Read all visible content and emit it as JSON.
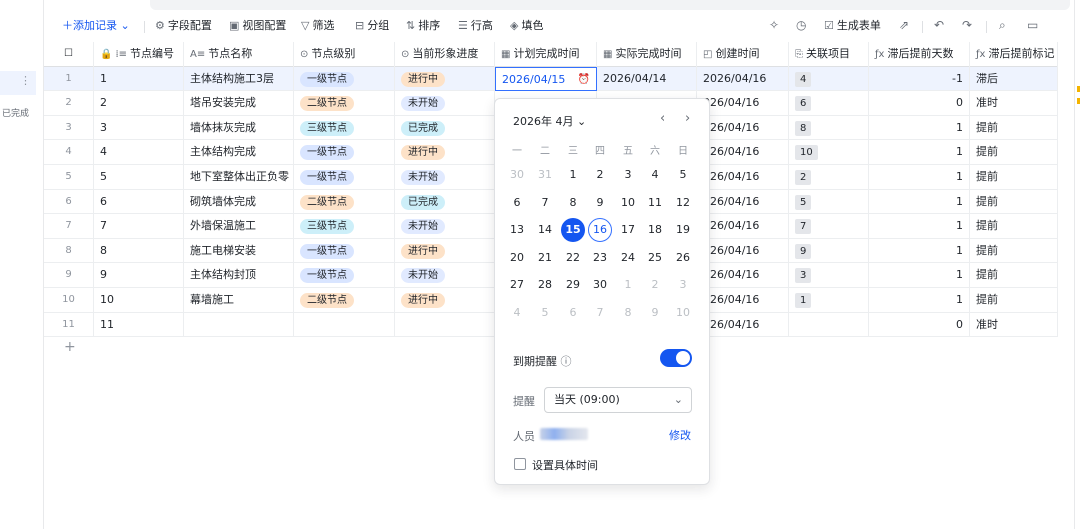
{
  "sidebar": {
    "status_label": "已完成"
  },
  "toolbar": {
    "add_record": "添加记录",
    "field_config": "字段配置",
    "view_config": "视图配置",
    "filter": "筛选",
    "group": "分组",
    "sort": "排序",
    "row_height": "行高",
    "fill_color": "填色",
    "generate_form": "生成表单"
  },
  "columns": [
    "节点编号",
    "节点名称",
    "节点级别",
    "当前形象进度",
    "计划完成时间",
    "实际完成时间",
    "创建时间",
    "关联项目",
    "滞后提前天数",
    "滞后提前标记"
  ],
  "rows": [
    {
      "rn": "1",
      "id": "1",
      "name": "主体结构施工3层",
      "level": "一级节点",
      "status": "进行中",
      "plan": "2026/04/15",
      "actual": "2026/04/14",
      "created": "2026/04/16",
      "rel": "4",
      "days": "-1",
      "mark": "滞后"
    },
    {
      "rn": "2",
      "id": "2",
      "name": "塔吊安装完成",
      "level": "二级节点",
      "status": "未开始",
      "plan": "",
      "actual": "",
      "created": "026/04/16",
      "rel": "6",
      "days": "0",
      "mark": "准时"
    },
    {
      "rn": "3",
      "id": "3",
      "name": "墙体抹灰完成",
      "level": "三级节点",
      "status": "已完成",
      "plan": "",
      "actual": "",
      "created": "026/04/16",
      "rel": "8",
      "days": "1",
      "mark": "提前"
    },
    {
      "rn": "4",
      "id": "4",
      "name": "主体结构完成",
      "level": "一级节点",
      "status": "进行中",
      "plan": "",
      "actual": "",
      "created": "026/04/16",
      "rel": "10",
      "days": "1",
      "mark": "提前"
    },
    {
      "rn": "5",
      "id": "5",
      "name": "地下室整体出正负零",
      "level": "一级节点",
      "status": "未开始",
      "plan": "",
      "actual": "",
      "created": "026/04/16",
      "rel": "2",
      "days": "1",
      "mark": "提前"
    },
    {
      "rn": "6",
      "id": "6",
      "name": "砌筑墙体完成",
      "level": "二级节点",
      "status": "已完成",
      "plan": "",
      "actual": "",
      "created": "026/04/16",
      "rel": "5",
      "days": "1",
      "mark": "提前"
    },
    {
      "rn": "7",
      "id": "7",
      "name": "外墙保温施工",
      "level": "三级节点",
      "status": "未开始",
      "plan": "",
      "actual": "",
      "created": "026/04/16",
      "rel": "7",
      "days": "1",
      "mark": "提前"
    },
    {
      "rn": "8",
      "id": "8",
      "name": "施工电梯安装",
      "level": "一级节点",
      "status": "进行中",
      "plan": "",
      "actual": "",
      "created": "026/04/16",
      "rel": "9",
      "days": "1",
      "mark": "提前"
    },
    {
      "rn": "9",
      "id": "9",
      "name": "主体结构封顶",
      "level": "一级节点",
      "status": "未开始",
      "plan": "",
      "actual": "",
      "created": "026/04/16",
      "rel": "3",
      "days": "1",
      "mark": "提前"
    },
    {
      "rn": "10",
      "id": "10",
      "name": "幕墙施工",
      "level": "二级节点",
      "status": "进行中",
      "plan": "",
      "actual": "",
      "created": "026/04/16",
      "rel": "1",
      "days": "1",
      "mark": "提前"
    },
    {
      "rn": "11",
      "id": "11",
      "name": "",
      "level": "",
      "status": "",
      "plan": "",
      "actual": "",
      "created": "026/04/16",
      "rel": "",
      "days": "0",
      "mark": "准时"
    }
  ],
  "calendar": {
    "month_label": "2026年 4月",
    "weekdays": [
      "一",
      "二",
      "三",
      "四",
      "五",
      "六",
      "日"
    ],
    "weeks": [
      [
        "30",
        "31",
        "1",
        "2",
        "3",
        "4",
        "5"
      ],
      [
        "6",
        "7",
        "8",
        "9",
        "10",
        "11",
        "12"
      ],
      [
        "13",
        "14",
        "15",
        "16",
        "17",
        "18",
        "19"
      ],
      [
        "20",
        "21",
        "22",
        "23",
        "24",
        "25",
        "26"
      ],
      [
        "27",
        "28",
        "29",
        "30",
        "1",
        "2",
        "3"
      ],
      [
        "4",
        "5",
        "6",
        "7",
        "8",
        "9",
        "10"
      ]
    ],
    "selected_day": "15",
    "today": "16",
    "reminder_label": "到期提醒",
    "remind_label": "提醒",
    "remind_value": "当天 (09:00)",
    "person_label": "人员",
    "modify": "修改",
    "specific_time": "设置具体时间"
  },
  "colors": {
    "accent": "#1456f0"
  }
}
